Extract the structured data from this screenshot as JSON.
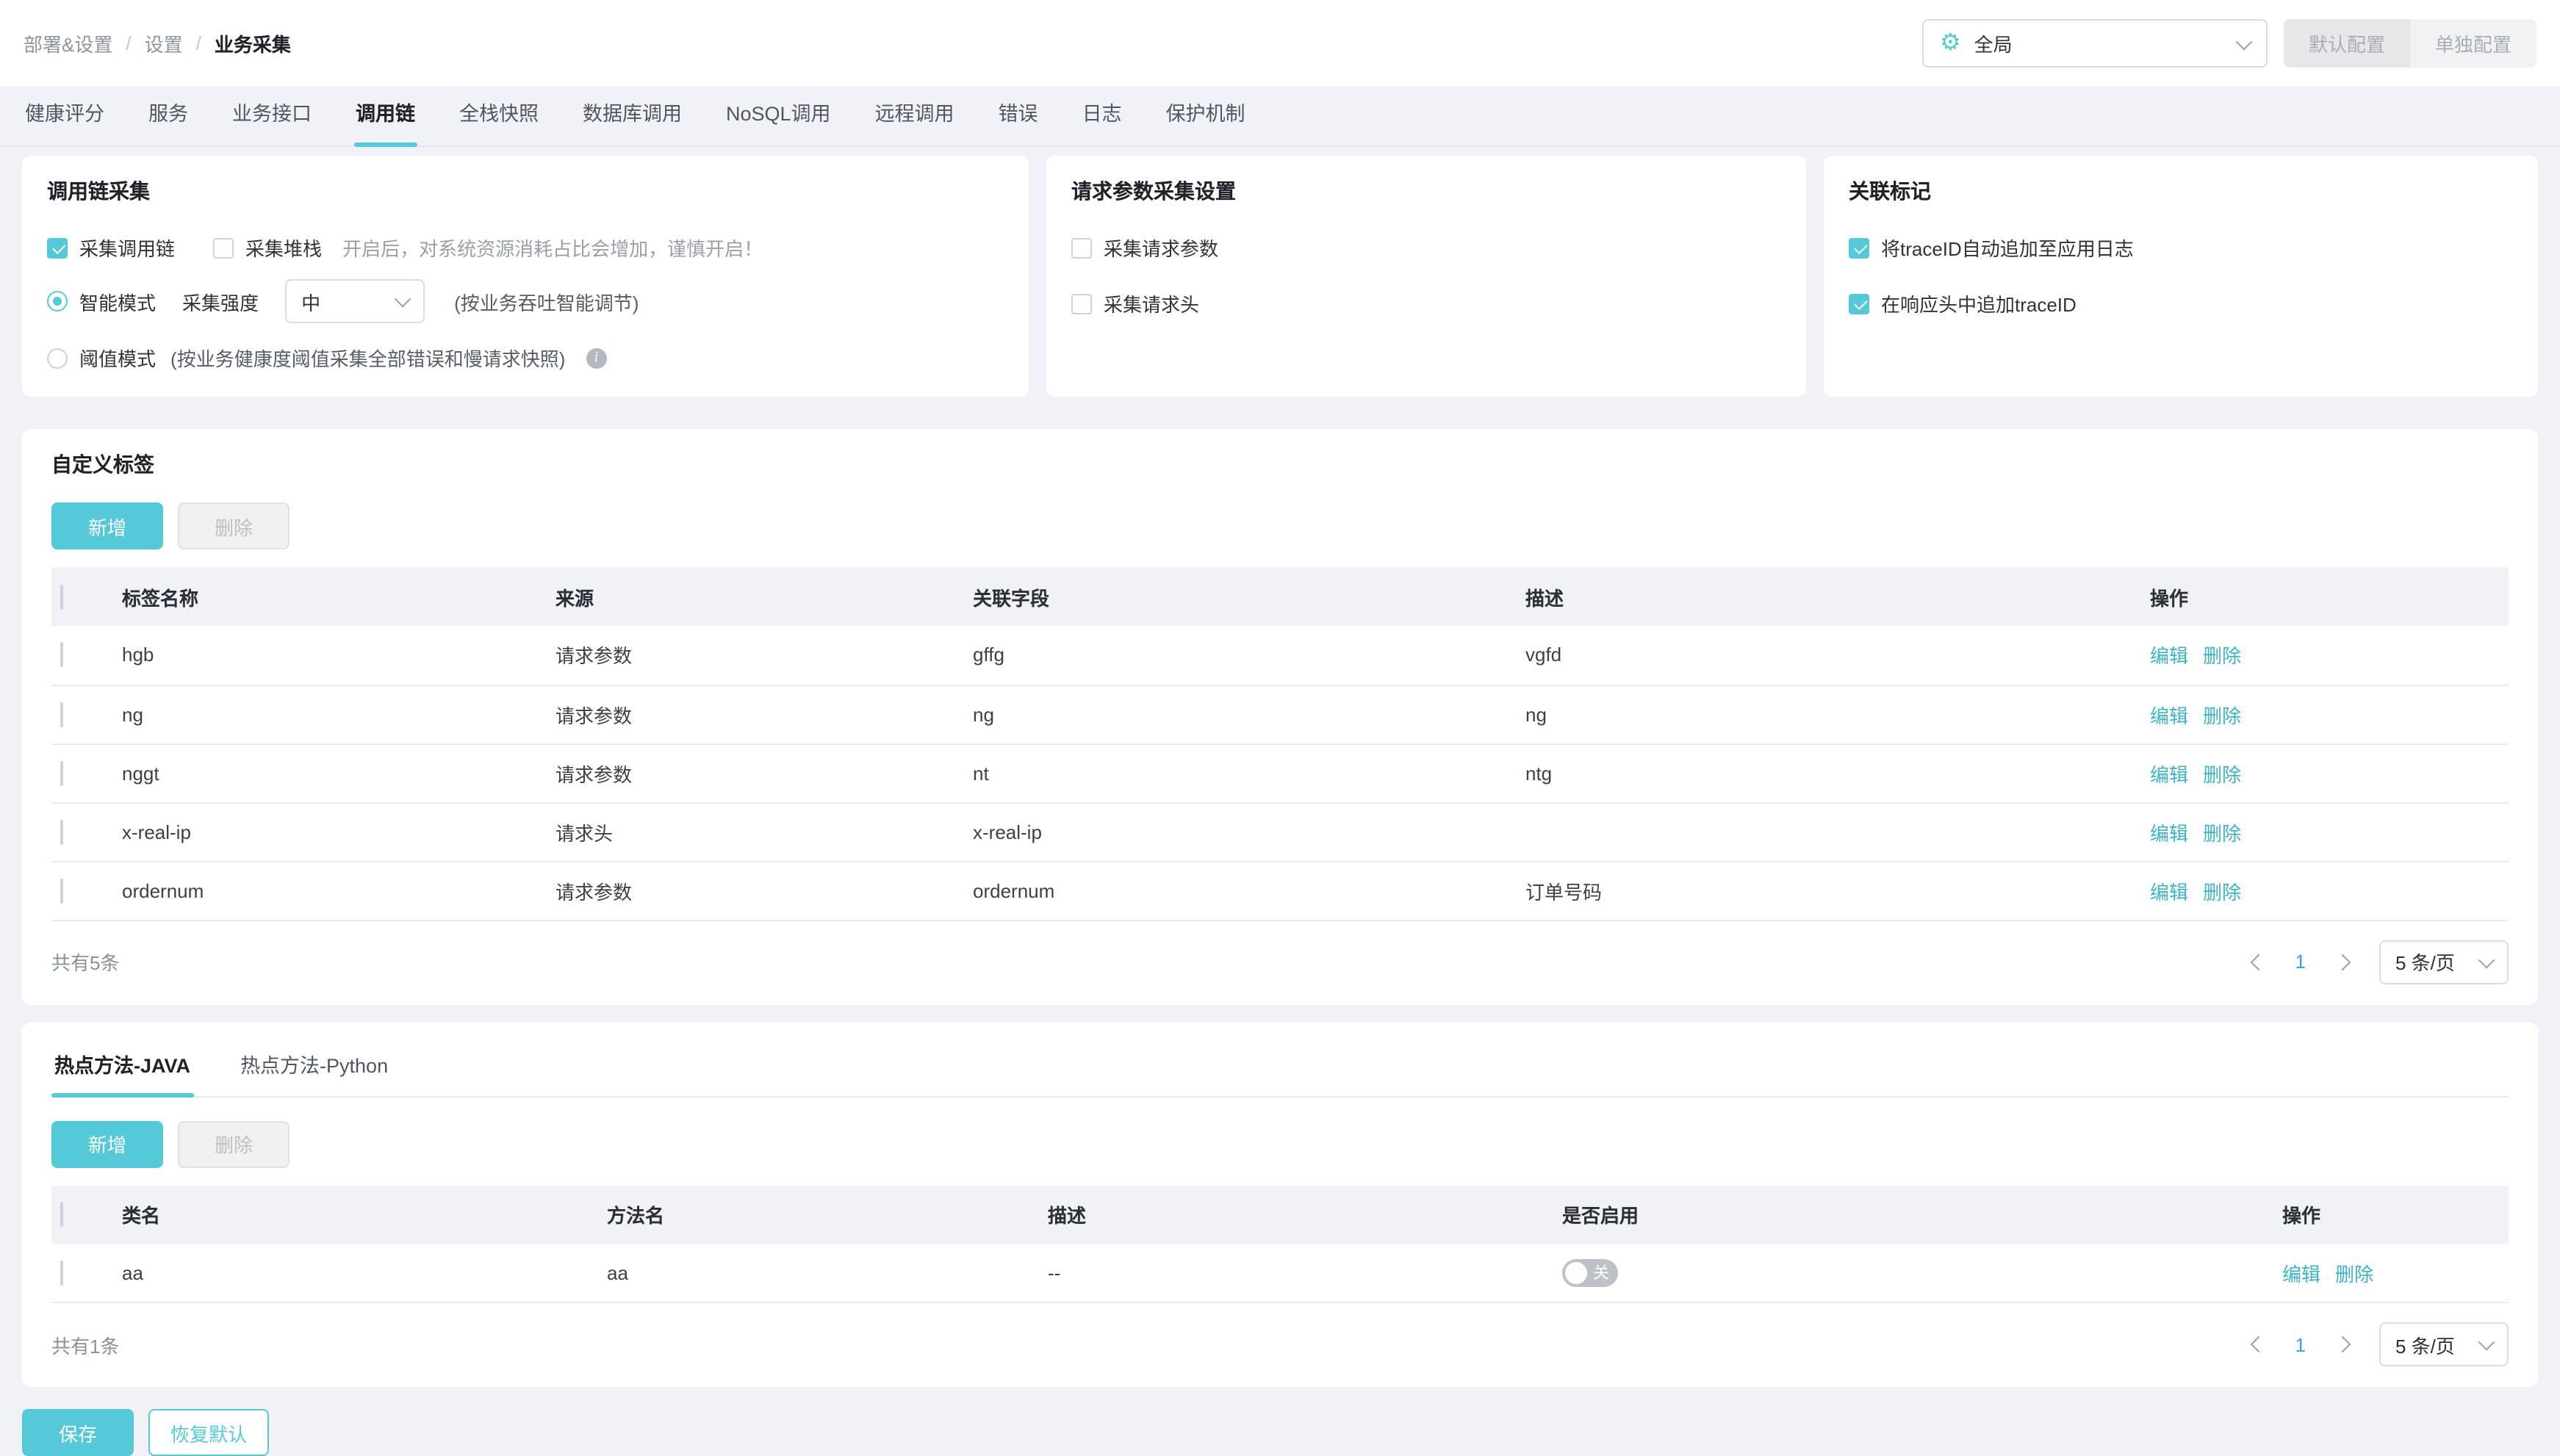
{
  "colors": {
    "accent": "#55c9d8",
    "link": "#3cb4c7",
    "page_active": "#3aa0e8"
  },
  "breadcrumb": {
    "items": [
      "部署&设置",
      "设置",
      "业务采集"
    ],
    "separator": "/"
  },
  "header": {
    "scope_select": {
      "value": "全局",
      "icon": "gear-icon"
    },
    "default_config_label": "默认配置",
    "separate_config_label": "单独配置"
  },
  "tabs": {
    "items": [
      "健康评分",
      "服务",
      "业务接口",
      "调用链",
      "全栈快照",
      "数据库调用",
      "NoSQL调用",
      "远程调用",
      "错误",
      "日志",
      "保护机制"
    ],
    "active": "调用链"
  },
  "cards": {
    "trace_collection": {
      "title": "调用链采集",
      "collect_trace": {
        "label": "采集调用链",
        "checked": true
      },
      "collect_stack": {
        "label": "采集堆栈",
        "checked": false,
        "hint": "开启后，对系统资源消耗占比会增加，谨慎开启！"
      },
      "smart_mode": {
        "label": "智能模式",
        "selected": true,
        "strength_label": "采集强度",
        "strength_value": "中",
        "hint": "(按业务吞吐智能调节)"
      },
      "threshold_mode": {
        "label": "阈值模式",
        "selected": false,
        "hint": "(按业务健康度阈值采集全部错误和慢请求快照)"
      }
    },
    "request_params": {
      "title": "请求参数采集设置",
      "options": [
        {
          "label": "采集请求参数",
          "checked": false
        },
        {
          "label": "采集请求头",
          "checked": false
        }
      ]
    },
    "correlation": {
      "title": "关联标记",
      "options": [
        {
          "label": "将traceID自动追加至应用日志",
          "checked": true
        },
        {
          "label": "在响应头中追加traceID",
          "checked": true
        }
      ]
    }
  },
  "custom_tags": {
    "title": "自定义标签",
    "add_label": "新增",
    "delete_label": "删除",
    "columns": [
      "标签名称",
      "来源",
      "关联字段",
      "描述",
      "操作"
    ],
    "rows": [
      {
        "name": "hgb",
        "source": "请求参数",
        "field": "gffg",
        "desc": "vgfd"
      },
      {
        "name": "ng",
        "source": "请求参数",
        "field": "ng",
        "desc": "ng"
      },
      {
        "name": "nggt",
        "source": "请求参数",
        "field": "nt",
        "desc": "ntg"
      },
      {
        "name": "x-real-ip",
        "source": "请求头",
        "field": "x-real-ip",
        "desc": ""
      },
      {
        "name": "ordernum",
        "source": "请求参数",
        "field": "ordernum",
        "desc": "订单号码"
      }
    ],
    "edit_label": "编辑",
    "remove_label": "删除",
    "pagination": {
      "total": "共有5条",
      "page": "1",
      "page_size": "5 条/页"
    }
  },
  "hot_methods": {
    "tabs": [
      {
        "label": "热点方法-JAVA",
        "active": true
      },
      {
        "label": "热点方法-Python",
        "active": false
      }
    ],
    "add_label": "新增",
    "delete_label": "删除",
    "columns": [
      "类名",
      "方法名",
      "描述",
      "是否启用",
      "操作"
    ],
    "rows": [
      {
        "class_name": "aa",
        "method": "aa",
        "desc": "--",
        "enabled": false,
        "toggle_label": "关"
      }
    ],
    "edit_label": "编辑",
    "remove_label": "删除",
    "pagination": {
      "total": "共有1条",
      "page": "1",
      "page_size": "5 条/页"
    }
  },
  "footer": {
    "save_label": "保存",
    "reset_label": "恢复默认"
  }
}
